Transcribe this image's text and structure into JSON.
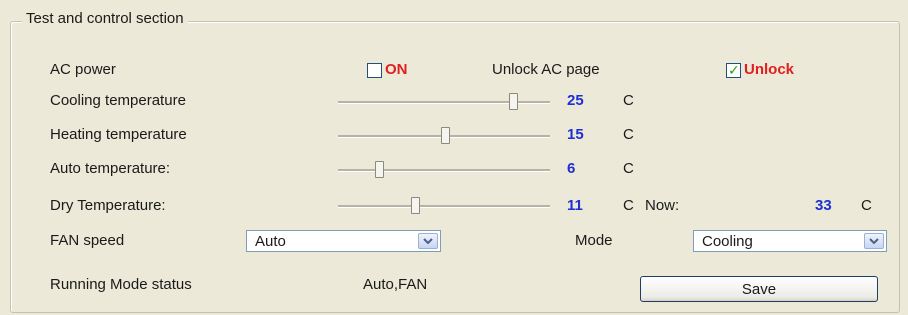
{
  "section": {
    "title": "Test and control section"
  },
  "ac_power": {
    "label": "AC power",
    "on_label": "ON",
    "checked": false
  },
  "unlock": {
    "label": "Unlock AC page",
    "checkbox_label": "Unlock",
    "checked": true
  },
  "sliders": {
    "cooling": {
      "label": "Cooling temperature",
      "value": "25",
      "unit": "C",
      "position": 0.83
    },
    "heating": {
      "label": "Heating temperature",
      "value": "15",
      "unit": "C",
      "position": 0.51
    },
    "auto": {
      "label": "Auto temperature:",
      "value": "6",
      "unit": "C",
      "position": 0.2
    },
    "dry": {
      "label": "Dry Temperature:",
      "value": "11",
      "unit": "C",
      "position": 0.37
    }
  },
  "now": {
    "label": "Now:",
    "value": "33",
    "unit": "C"
  },
  "fan": {
    "label": "FAN speed",
    "value": "Auto"
  },
  "mode": {
    "label": "Mode",
    "value": "Cooling"
  },
  "status": {
    "label": "Running Mode status",
    "value": "Auto,FAN"
  },
  "save_label": "Save",
  "colors": {
    "on": "#e01f1f",
    "value": "#1e2fd3",
    "check": "#21a121"
  }
}
